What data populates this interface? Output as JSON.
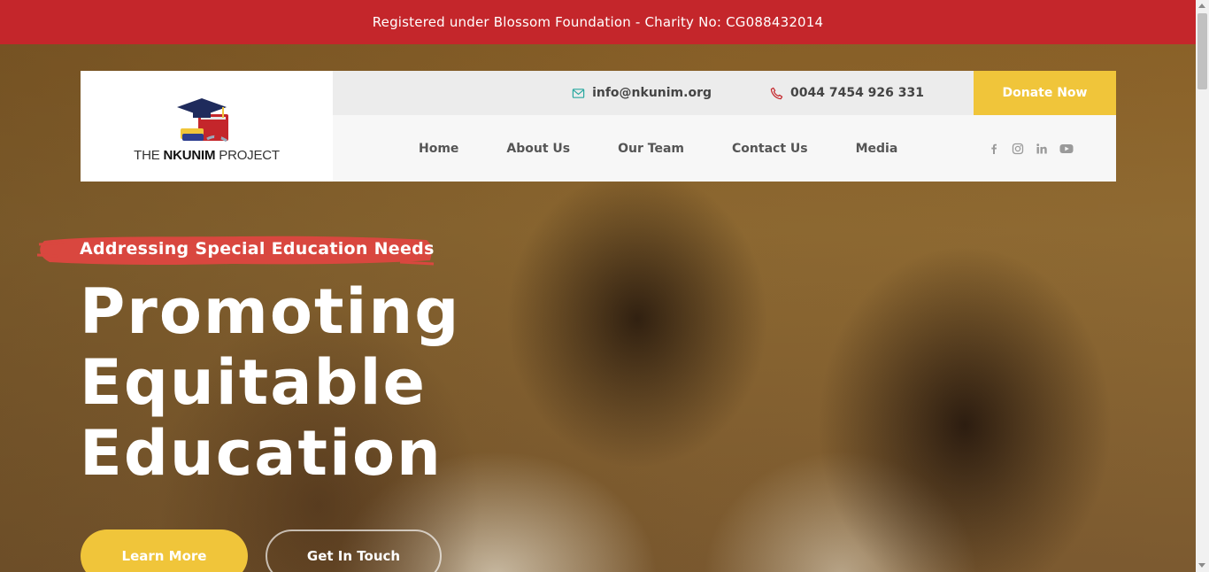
{
  "topbar": {
    "text": "Registered under Blossom Foundation - Charity No: CG088432014"
  },
  "logo": {
    "text_pre": "THE ",
    "text_bold": "NKUNIM",
    "text_post": " PROJECT",
    "icon": "graduation-cap-books-icon"
  },
  "contact": {
    "email": "info@nkunim.org",
    "email_icon": "envelope-icon",
    "phone": "0044 7454 926 331",
    "phone_icon": "phone-icon"
  },
  "donate_label": "Donate Now",
  "nav": {
    "items": [
      {
        "label": "Home"
      },
      {
        "label": "About Us"
      },
      {
        "label": "Our Team"
      },
      {
        "label": "Contact Us"
      },
      {
        "label": "Media"
      }
    ]
  },
  "social": [
    "facebook-icon",
    "instagram-icon",
    "linkedin-icon",
    "youtube-icon"
  ],
  "hero": {
    "eyebrow": "Addressing Special Education Needs",
    "headline": [
      "Promoting",
      "Equitable",
      "Education"
    ],
    "primary_button": "Learn More",
    "secondary_button": "Get In Touch"
  },
  "colors": {
    "topbar_red": "#c4262b",
    "accent_yellow": "#f0c53a",
    "brush_red": "#d9473f",
    "phone_red": "#c4262b",
    "email_teal": "#2aa8a0"
  }
}
